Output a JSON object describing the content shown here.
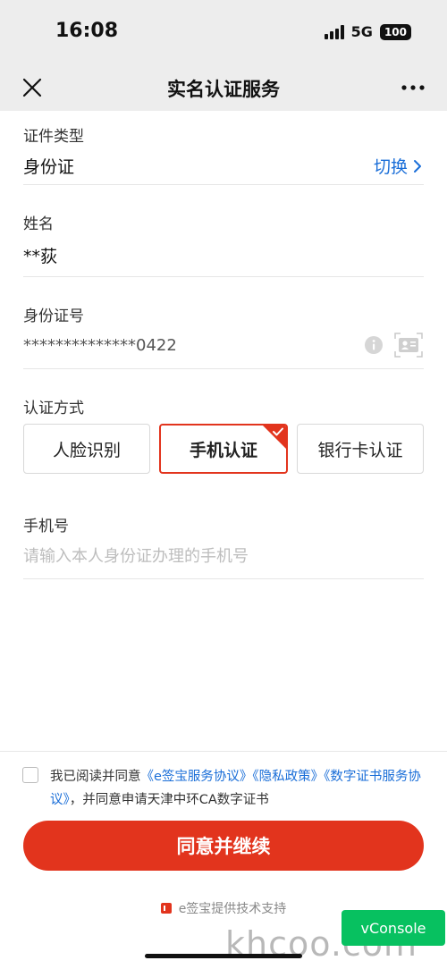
{
  "status_bar": {
    "time": "16:08",
    "network": "5G",
    "battery": "100"
  },
  "nav": {
    "title": "实名认证服务",
    "close_icon": "close-icon",
    "more_icon": "more-icon"
  },
  "id_type": {
    "label": "证件类型",
    "value": "身份证",
    "switch_label": "切换"
  },
  "name": {
    "label": "姓名",
    "value": "**荻"
  },
  "id_number": {
    "label": "身份证号",
    "value": "**************0422"
  },
  "auth_method": {
    "label": "认证方式",
    "options": [
      "人脸识别",
      "手机认证",
      "银行卡认证"
    ],
    "selected": "手机认证"
  },
  "phone": {
    "label": "手机号",
    "placeholder": "请输入本人身份证办理的手机号",
    "value": ""
  },
  "agreement": {
    "prefix": "我已阅读并同意",
    "link1": "《e签宝服务协议》",
    "link2": "《隐私政策》",
    "link3": "《数字证书服务协议》",
    "suffix": "，并同意申请天津中环CA数字证书"
  },
  "submit_label": "同意并继续",
  "powered_by": "e签宝提供技术支持",
  "vconsole_label": "vConsole",
  "watermark": "khcoo.com",
  "colors": {
    "accent": "#e2341d",
    "link": "#1a6ed8",
    "vconsole": "#07c160"
  }
}
